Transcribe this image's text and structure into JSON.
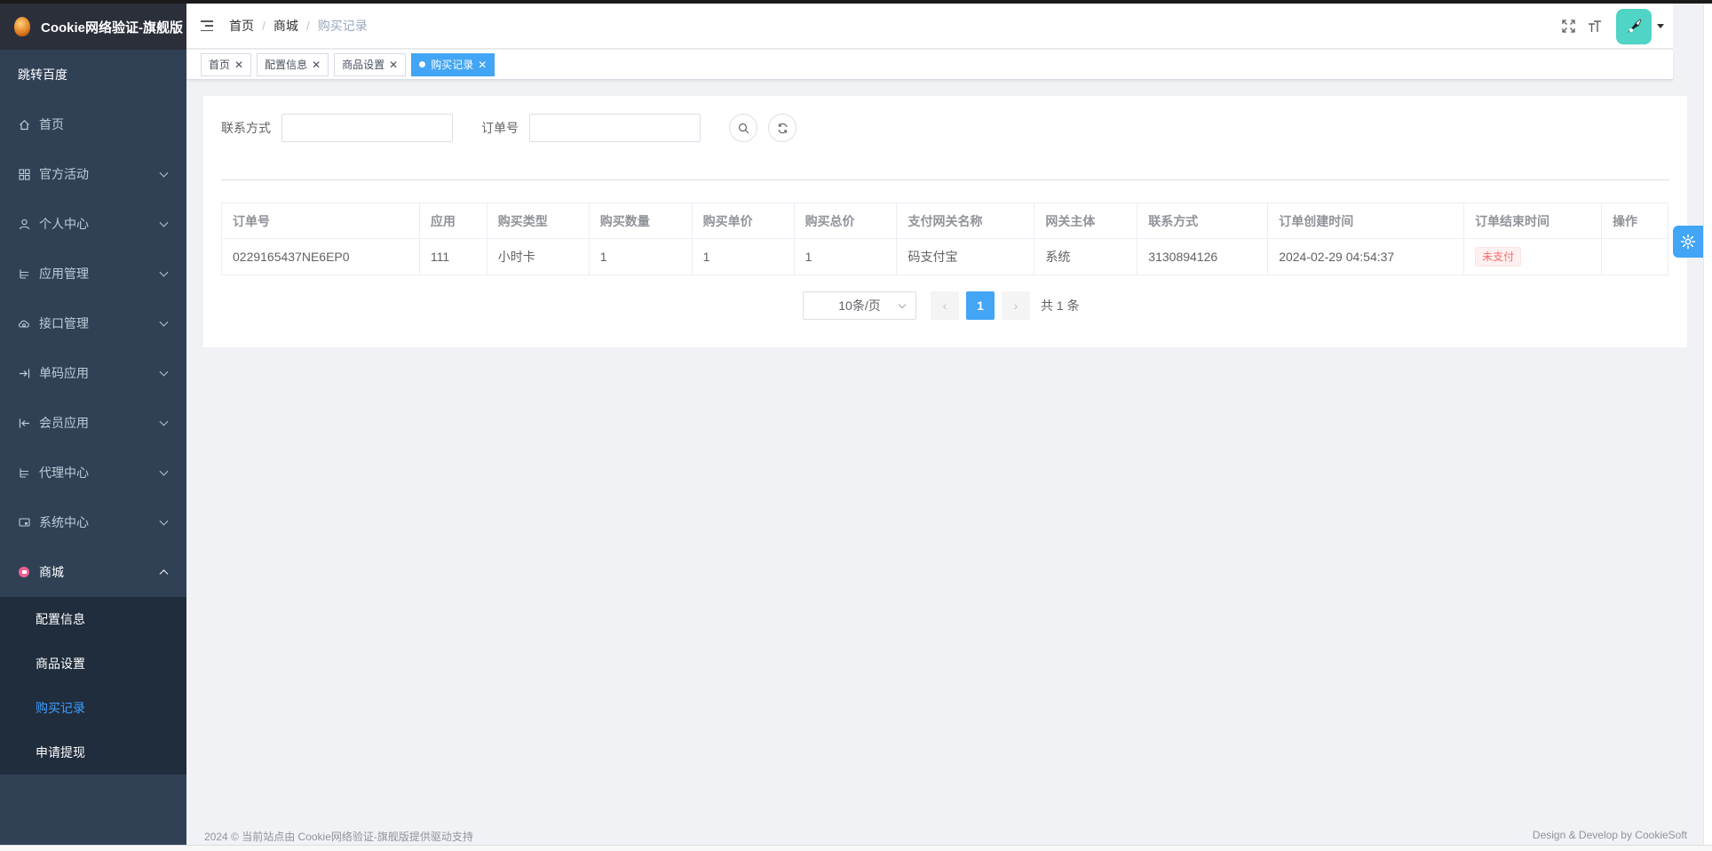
{
  "app": {
    "title": "Cookie网络验证-旗舰版"
  },
  "sidebar": {
    "jump": "跳转百度",
    "items": [
      {
        "label": "首页",
        "icon": "home-icon",
        "has_children": false
      },
      {
        "label": "官方活动",
        "icon": "grid-icon",
        "has_children": true
      },
      {
        "label": "个人中心",
        "icon": "user-icon",
        "has_children": true
      },
      {
        "label": "应用管理",
        "icon": "tree-icon",
        "has_children": true
      },
      {
        "label": "接口管理",
        "icon": "cloud-icon",
        "has_children": true
      },
      {
        "label": "单码应用",
        "icon": "login-arrow-icon",
        "has_children": true
      },
      {
        "label": "会员应用",
        "icon": "logout-arrow-icon",
        "has_children": true
      },
      {
        "label": "代理中心",
        "icon": "tree-icon",
        "has_children": true
      },
      {
        "label": "系统中心",
        "icon": "monitor-icon",
        "has_children": true
      },
      {
        "label": "商城",
        "icon": "shop-icon",
        "has_children": true,
        "open": true
      }
    ],
    "shop_submenu": [
      {
        "label": "配置信息"
      },
      {
        "label": "商品设置"
      },
      {
        "label": "购买记录",
        "active": true
      },
      {
        "label": "申请提现"
      }
    ]
  },
  "header": {
    "breadcrumb": [
      "首页",
      "商城",
      "购买记录"
    ]
  },
  "tags": [
    {
      "label": "首页"
    },
    {
      "label": "配置信息"
    },
    {
      "label": "商品设置"
    },
    {
      "label": "购买记录",
      "active": true
    }
  ],
  "filter": {
    "contact_label": "联系方式",
    "contact_value": "",
    "order_label": "订单号",
    "order_value": ""
  },
  "table": {
    "columns": [
      "订单号",
      "应用",
      "购买类型",
      "购买数量",
      "购买单价",
      "购买总价",
      "支付网关名称",
      "网关主体",
      "联系方式",
      "订单创建时间",
      "订单结束时间",
      "操作"
    ],
    "rows": [
      {
        "order_no": "0229165437NE6EP0",
        "app": "111",
        "type": "小时卡",
        "qty": "1",
        "unit_price": "1",
        "total_price": "1",
        "gateway": "码支付宝",
        "gateway_subject": "系统",
        "contact": "3130894126",
        "created": "2024-02-29 04:54:37",
        "status": "未支付"
      }
    ]
  },
  "pagination": {
    "page_size": "10条/页",
    "current_page": "1",
    "total": "共 1 条"
  },
  "footer": {
    "left": "2024 © 当前站点由 Cookie网络验证-旗舰版提供驱动支持",
    "right": "Design & Develop by CookieSoft"
  },
  "colors": {
    "sidebar_bg": "#304156",
    "accent": "#42a5f5",
    "active_submenu": "#409eff",
    "danger": "#f56c6c"
  }
}
